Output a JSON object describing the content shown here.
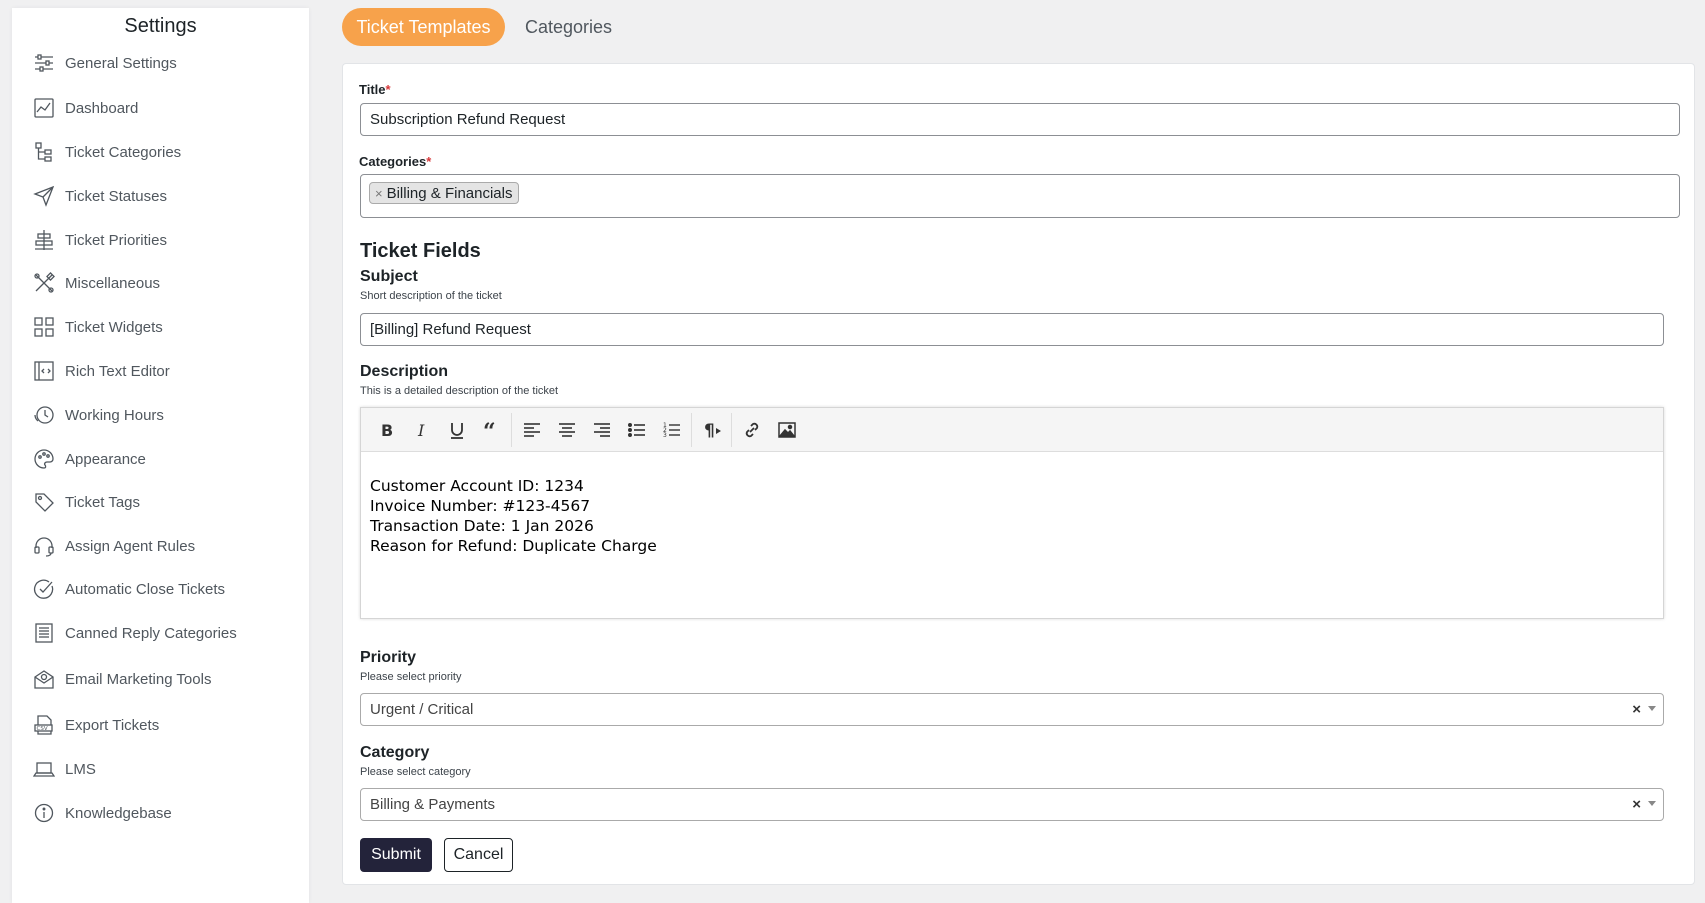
{
  "sidebar": {
    "title": "Settings",
    "items": [
      {
        "label": "General Settings",
        "icon": "sliders-icon"
      },
      {
        "label": "Dashboard",
        "icon": "dashboard-chart-icon"
      },
      {
        "label": "Ticket Categories",
        "icon": "category-tree-icon"
      },
      {
        "label": "Ticket Statuses",
        "icon": "send-icon"
      },
      {
        "label": "Ticket Priorities",
        "icon": "priority-icon"
      },
      {
        "label": "Miscellaneous",
        "icon": "tools-icon"
      },
      {
        "label": "Ticket Widgets",
        "icon": "widgets-icon"
      },
      {
        "label": "Rich Text Editor",
        "icon": "code-editor-icon"
      },
      {
        "label": "Working Hours",
        "icon": "clock-icon"
      },
      {
        "label": "Appearance",
        "icon": "palette-icon"
      },
      {
        "label": "Ticket Tags",
        "icon": "tag-icon"
      },
      {
        "label": "Assign Agent Rules",
        "icon": "headset-icon"
      },
      {
        "label": "Automatic Close Tickets",
        "icon": "check-circle-icon"
      },
      {
        "label": "Canned Reply Categories",
        "icon": "document-list-icon"
      },
      {
        "label": "Email Marketing Tools",
        "icon": "envelope-icon"
      },
      {
        "label": "Export Tickets",
        "icon": "csv-file-icon"
      },
      {
        "label": "LMS",
        "icon": "laptop-icon"
      },
      {
        "label": "Knowledgebase",
        "icon": "info-icon"
      }
    ]
  },
  "tabs": {
    "active": "Ticket Templates",
    "inactive": "Categories"
  },
  "form": {
    "title_label": "Title",
    "title_required": "*",
    "title_value": "Subscription Refund Request",
    "categories_label": "Categories",
    "categories_required": "*",
    "category_tag": "Billing & Financials",
    "category_tag_remove": "×",
    "section_title": "Ticket Fields",
    "subject_label": "Subject",
    "subject_help": "Short description of the ticket",
    "subject_value": "[Billing] Refund Request",
    "description_label": "Description",
    "description_help": "This is a detailed description of the ticket",
    "description_lines": [
      "Customer Account ID: 1234",
      "Invoice Number: #123-4567",
      "Transaction Date: 1 Jan 2026",
      "Reason for Refund: Duplicate Charge"
    ],
    "priority_label": "Priority",
    "priority_help": "Please select priority",
    "priority_value": "Urgent / Critical",
    "category_label": "Category",
    "category_help": "Please select category",
    "category_value": "Billing & Payments",
    "clear_symbol": "×",
    "submit_label": "Submit",
    "cancel_label": "Cancel"
  },
  "toolbar": {
    "buttons": [
      "bold-icon",
      "italic-icon",
      "underline-icon",
      "blockquote-icon",
      "align-left-icon",
      "align-center-icon",
      "align-right-icon",
      "bullet-list-icon",
      "numbered-list-icon",
      "paragraph-icon",
      "link-icon",
      "image-icon"
    ]
  },
  "colors": {
    "accent": "#f7a24b",
    "submit_bg": "#23233a",
    "page_bg": "#f0f0f1"
  }
}
